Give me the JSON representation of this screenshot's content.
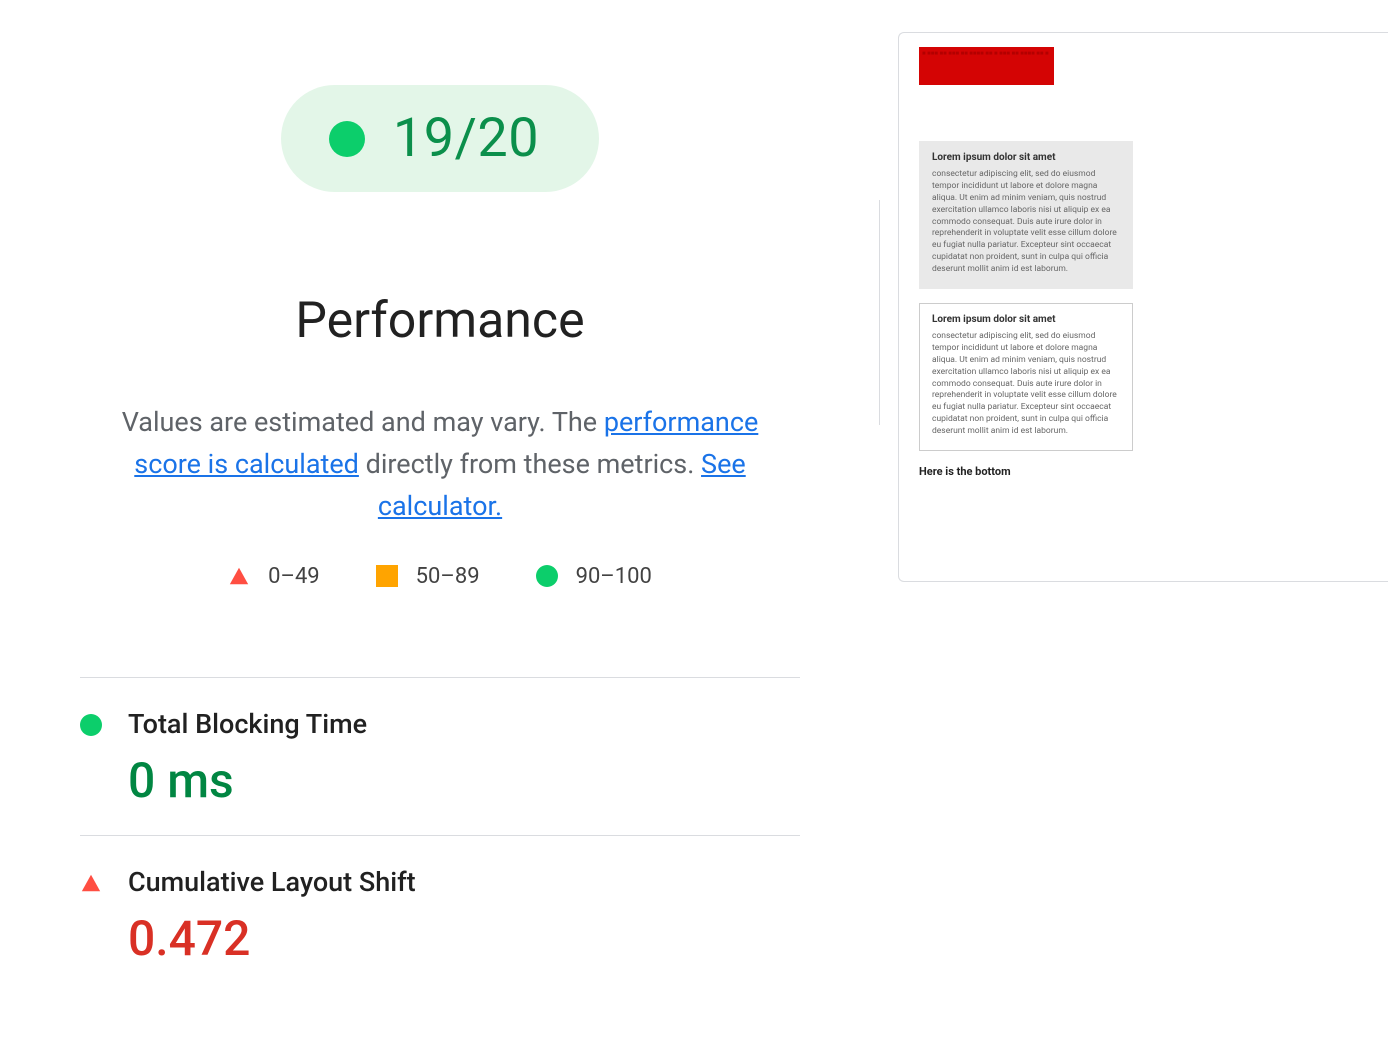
{
  "summary": {
    "score_fraction": "19/20"
  },
  "section_title": "Performance",
  "description": {
    "intro": "Values are estimated and may vary. The ",
    "link1": "performance score is calculated",
    "mid": " directly from these metrics. ",
    "link2": "See calculator."
  },
  "legend": {
    "poor": "0–49",
    "average": "50–89",
    "good": "90–100"
  },
  "metrics": [
    {
      "label": "Total Blocking Time",
      "value": "0 ms",
      "status": "good",
      "shape": "circle"
    },
    {
      "label": "Cumulative Layout Shift",
      "value": "0.472",
      "status": "poor",
      "shape": "triangle"
    }
  ],
  "thumbnail": {
    "card_heading": "Lorem ipsum dolor sit amet",
    "card_body": "consectetur adipiscing elit, sed do eiusmod tempor incididunt ut labore et dolore magna aliqua. Ut enim ad minim veniam, quis nostrud exercitation ullamco laboris nisi ut aliquip ex ea commodo consequat. Duis aute irure dolor in reprehenderit in voluptate velit esse cillum dolore eu fugiat nulla pariatur. Excepteur sint occaecat cupidatat non proident, sunt in culpa qui officia deserunt mollit anim id est laborum.",
    "bottom": "Here is the bottom"
  },
  "colors": {
    "good": "#0cce6b",
    "average": "#ffa400",
    "poor": "#ff4e42",
    "good_text": "#018642",
    "poor_text": "#d93025",
    "link": "#1a73e8"
  }
}
